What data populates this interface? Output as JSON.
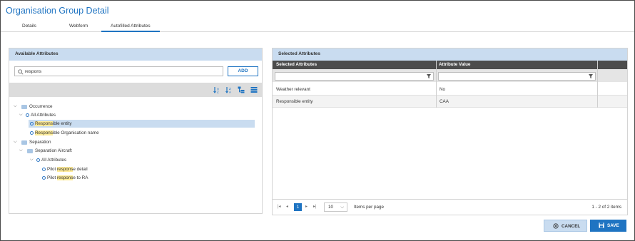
{
  "page": {
    "title": "Organisation Group Detail"
  },
  "tabs": [
    {
      "label": "Details"
    },
    {
      "label": "Webform"
    },
    {
      "label": "Autofilled Attributes",
      "active": true
    }
  ],
  "available": {
    "header": "Available Attributes",
    "search": {
      "value": "respons",
      "placeholder": ""
    },
    "add_label": "ADD",
    "toolbar_icons": [
      "sort-asc-icon",
      "sort-desc-icon",
      "tree-view-icon",
      "list-view-icon"
    ],
    "tree": {
      "occurrence": {
        "label": "Occurrence"
      },
      "occ_all_attributes": {
        "label": "All Attributes"
      },
      "responsible_entity": {
        "match": "Respons",
        "rest": "ible entity",
        "selected": true
      },
      "responsible_org": {
        "match": "Respons",
        "rest": "ible Organisation name"
      },
      "separation": {
        "label": "Separation"
      },
      "separation_aircraft": {
        "label": "Separation Aircraft"
      },
      "sep_all_attributes": {
        "label": "All Attributes"
      },
      "pilot_response_detail": {
        "pre": "Pilot ",
        "match": "respons",
        "rest": "e detail"
      },
      "pilot_response_ra": {
        "pre": "Pilot ",
        "match": "respons",
        "rest": "e to RA"
      }
    }
  },
  "selected": {
    "header": "Selected Attributes",
    "columns": [
      "Selected Attributes",
      "Attribute Value"
    ],
    "rows": [
      {
        "attribute": "Weather relevant",
        "value": "No"
      },
      {
        "attribute": "Responsible entity",
        "value": "CAA"
      }
    ],
    "pager": {
      "current_page": "1",
      "page_size": "10",
      "items_per_page_label": "Items per page",
      "count_label": "1 - 2 of 2 items"
    }
  },
  "footer": {
    "cancel_label": "CANCEL",
    "save_label": "SAVE"
  },
  "colors": {
    "accent": "#1f74c2",
    "panel_header": "#c9dcf0",
    "grid_header": "#4c4c4c",
    "highlight": "#ffec99"
  }
}
